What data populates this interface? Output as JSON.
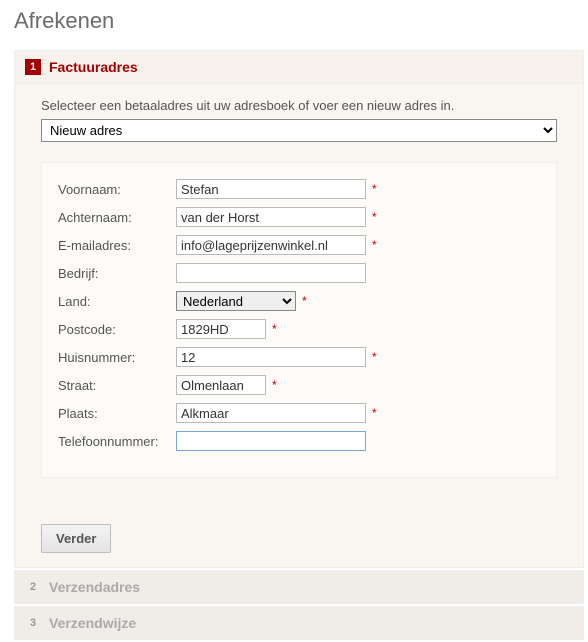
{
  "page_title": "Afrekenen",
  "step1": {
    "number": "1",
    "title": "Factuuradres",
    "intro": "Selecteer een betaaladres uit uw adresboek of voer een nieuw adres in.",
    "address_select_value": "Nieuw adres",
    "labels": {
      "voornaam": "Voornaam:",
      "achternaam": "Achternaam:",
      "email": "E-mailadres:",
      "bedrijf": "Bedrijf:",
      "land": "Land:",
      "postcode": "Postcode:",
      "huisnummer": "Huisnummer:",
      "straat": "Straat:",
      "plaats": "Plaats:",
      "telefoon": "Telefoonnummer:"
    },
    "values": {
      "voornaam": "Stefan",
      "achternaam": "van der Horst",
      "email": "info@lageprijzenwinkel.nl",
      "bedrijf": "",
      "land": "Nederland",
      "postcode": "1829HD",
      "huisnummer": "12",
      "straat": "Olmenlaan",
      "plaats": "Alkmaar",
      "telefoon": ""
    },
    "button": "Verder"
  },
  "step2": {
    "number": "2",
    "title": "Verzendadres"
  },
  "step3": {
    "number": "3",
    "title": "Verzendwijze"
  },
  "required_mark": "*"
}
